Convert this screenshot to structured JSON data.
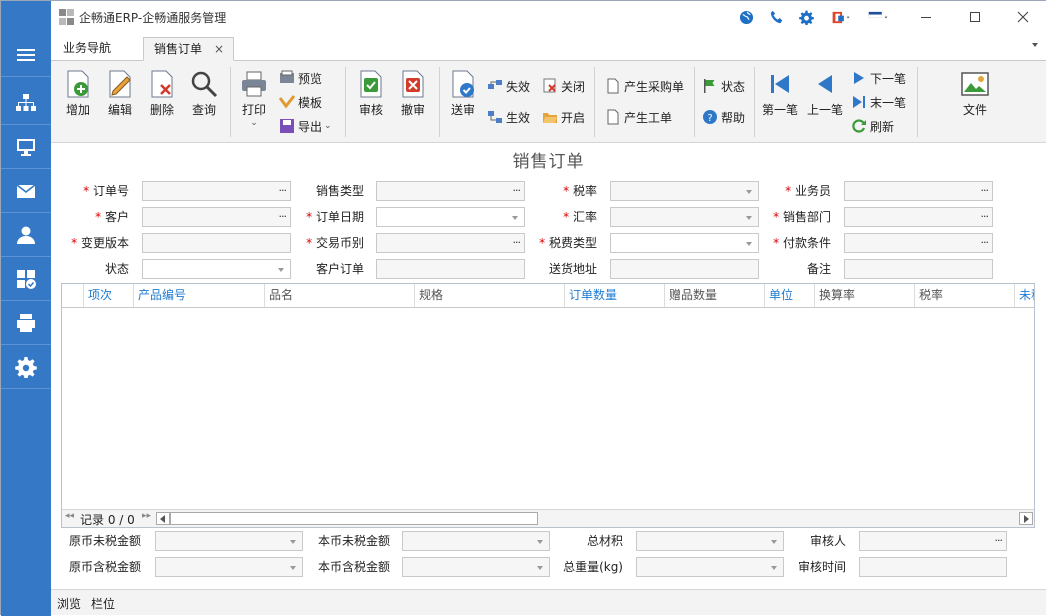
{
  "window": {
    "title": "企畅通ERP-企畅通服务管理"
  },
  "sidebar": {
    "items": [
      "menu-icon",
      "org-chart-icon",
      "monitor-icon",
      "mail-icon",
      "user-icon",
      "apps-check-icon",
      "print-icon",
      "gear-icon"
    ]
  },
  "tabs": [
    {
      "label": "业务导航"
    },
    {
      "label": "销售订单",
      "close": "×"
    }
  ],
  "ribbon": {
    "add": "增加",
    "edit": "编辑",
    "delete": "删除",
    "query": "查询",
    "print": "打印",
    "preview": "预览",
    "template": "模板",
    "export": "导出",
    "approve": "审核",
    "unapprove": "撤审",
    "send_approve": "送审",
    "invalid": "失效",
    "valid": "生效",
    "close": "关闭",
    "open": "开启",
    "gen_purchase": "产生采购单",
    "gen_work": "产生工单",
    "state": "状态",
    "help": "帮助",
    "first": "第一笔",
    "prev": "上一笔",
    "next": "下一笔",
    "last": "末一笔",
    "refresh": "刷新",
    "file": "文件"
  },
  "form": {
    "title": "销售订单",
    "required_mark": "*",
    "labels": {
      "order_no": "订单号",
      "customer": "客户",
      "version": "变更版本",
      "state": "状态",
      "sale_type": "销售类型",
      "order_date": "订单日期",
      "currency": "交易币别",
      "customer_order": "客户订单",
      "tax_rate": "税率",
      "exchange_rate": "汇率",
      "tax_type": "税费类型",
      "ship_addr": "送货地址",
      "salesman": "业务员",
      "sales_dept": "销售部门",
      "pay_terms": "付款条件",
      "remark": "备注"
    }
  },
  "grid": {
    "columns": [
      "项次",
      "产品编号",
      "品名",
      "规格",
      "订单数量",
      "赠品数量",
      "单位",
      "换算率",
      "税率",
      "未税"
    ],
    "record_text": "记录 0 / 0"
  },
  "totals": {
    "orig_untaxed": "原币未税金额",
    "local_untaxed": "本币未税金额",
    "total_volume": "总材积",
    "approver": "审核人",
    "orig_taxed": "原币含税金额",
    "local_taxed": "本币含税金额",
    "total_weight": "总重量(kg)",
    "approve_time": "审核时间"
  },
  "status": {
    "browse": "浏览",
    "columns": "栏位"
  },
  "colors": {
    "sidebar": "#3478c6",
    "accent": "#1f7bd0",
    "required": "#dd0000"
  }
}
